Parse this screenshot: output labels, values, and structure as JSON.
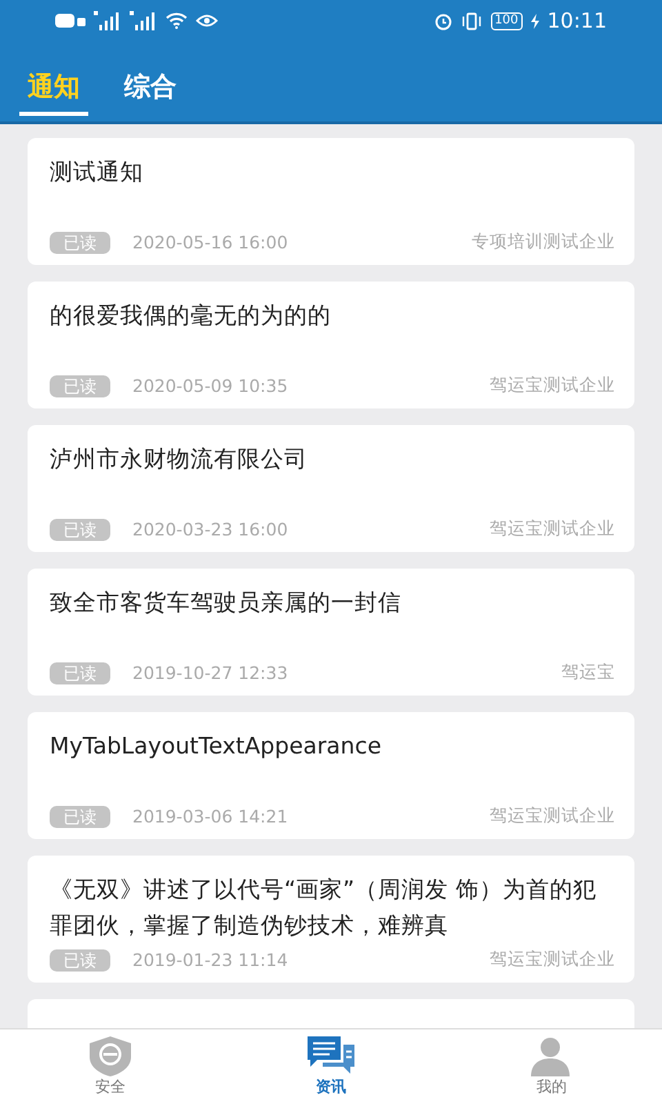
{
  "status_bar": {
    "battery": "100",
    "time": "10:11"
  },
  "tabs": [
    {
      "label": "通知",
      "selected": true
    },
    {
      "label": "综合",
      "selected": false
    }
  ],
  "notices": [
    {
      "title": "测试通知",
      "badge": "已读",
      "read": true,
      "date": "2020-05-16 16:00",
      "source": "专项培训测试企业"
    },
    {
      "title": "的很爱我偶的毫无的为的的",
      "badge": "已读",
      "read": true,
      "date": "2020-05-09 10:35",
      "source": "驾运宝测试企业"
    },
    {
      "title": "泸州市永财物流有限公司",
      "badge": "已读",
      "read": true,
      "date": "2020-03-23 16:00",
      "source": "驾运宝测试企业"
    },
    {
      "title": "致全市客货车驾驶员亲属的一封信",
      "badge": "已读",
      "read": true,
      "date": "2019-10-27 12:33",
      "source": "驾运宝"
    },
    {
      "title": "MyTabLayoutTextAppearance",
      "badge": "已读",
      "read": true,
      "date": "2019-03-06 14:21",
      "source": "驾运宝测试企业"
    },
    {
      "title": "《无双》讲述了以代号“画家”（周润发 饰）为首的犯罪团伙，掌握了制造伪钞技术，难辨真",
      "badge": "已读",
      "read": true,
      "date": "2019-01-23 11:14",
      "source": "驾运宝测试企业"
    }
  ],
  "bottom_nav": [
    {
      "kind": "shield",
      "label": "安全",
      "selected": false
    },
    {
      "kind": "chat",
      "label": "资讯",
      "selected": true
    },
    {
      "kind": "person",
      "label": "我的",
      "selected": false
    }
  ]
}
